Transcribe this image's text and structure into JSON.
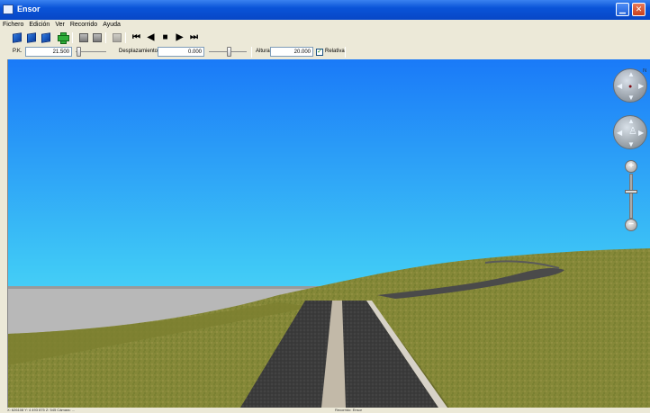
{
  "window": {
    "title": "Ensor"
  },
  "menu": {
    "items": [
      "Fichero",
      "Edición",
      "Ver",
      "Recorrido",
      "Ayuda"
    ]
  },
  "toolbar": {
    "media_first": "⏮",
    "media_prev": "◀",
    "media_stop": "■",
    "media_next": "▶",
    "media_last": "⏭"
  },
  "params": {
    "pk_label": "P.K.",
    "pk_value": "21.500",
    "desplazamiento_label": "Desplazamiento",
    "desplazamiento_value": "0.000",
    "altura_label": "Altura",
    "altura_value": "20.000",
    "relativa_label": "Relativa",
    "relativa_checked": true,
    "relativa_mark": "✓",
    "pk_level": 0.05,
    "desplazamiento_level": 0.55
  },
  "navigation": {
    "zoom_in": "+",
    "zoom_out": "−",
    "north_mark": "N",
    "zoom_level": 0.6
  },
  "status": {
    "left": "X: 626108  Y: 4 493 875  Z: 545   Cámara: ...",
    "center": "Recorrido: Ensor"
  },
  "colors": {
    "sky_top": "#1a7af8",
    "sky_bottom": "#5ce8f6",
    "grass": "#8b8c3c",
    "road": "#3a3a3a",
    "water_plane": "#b8b8b8"
  }
}
